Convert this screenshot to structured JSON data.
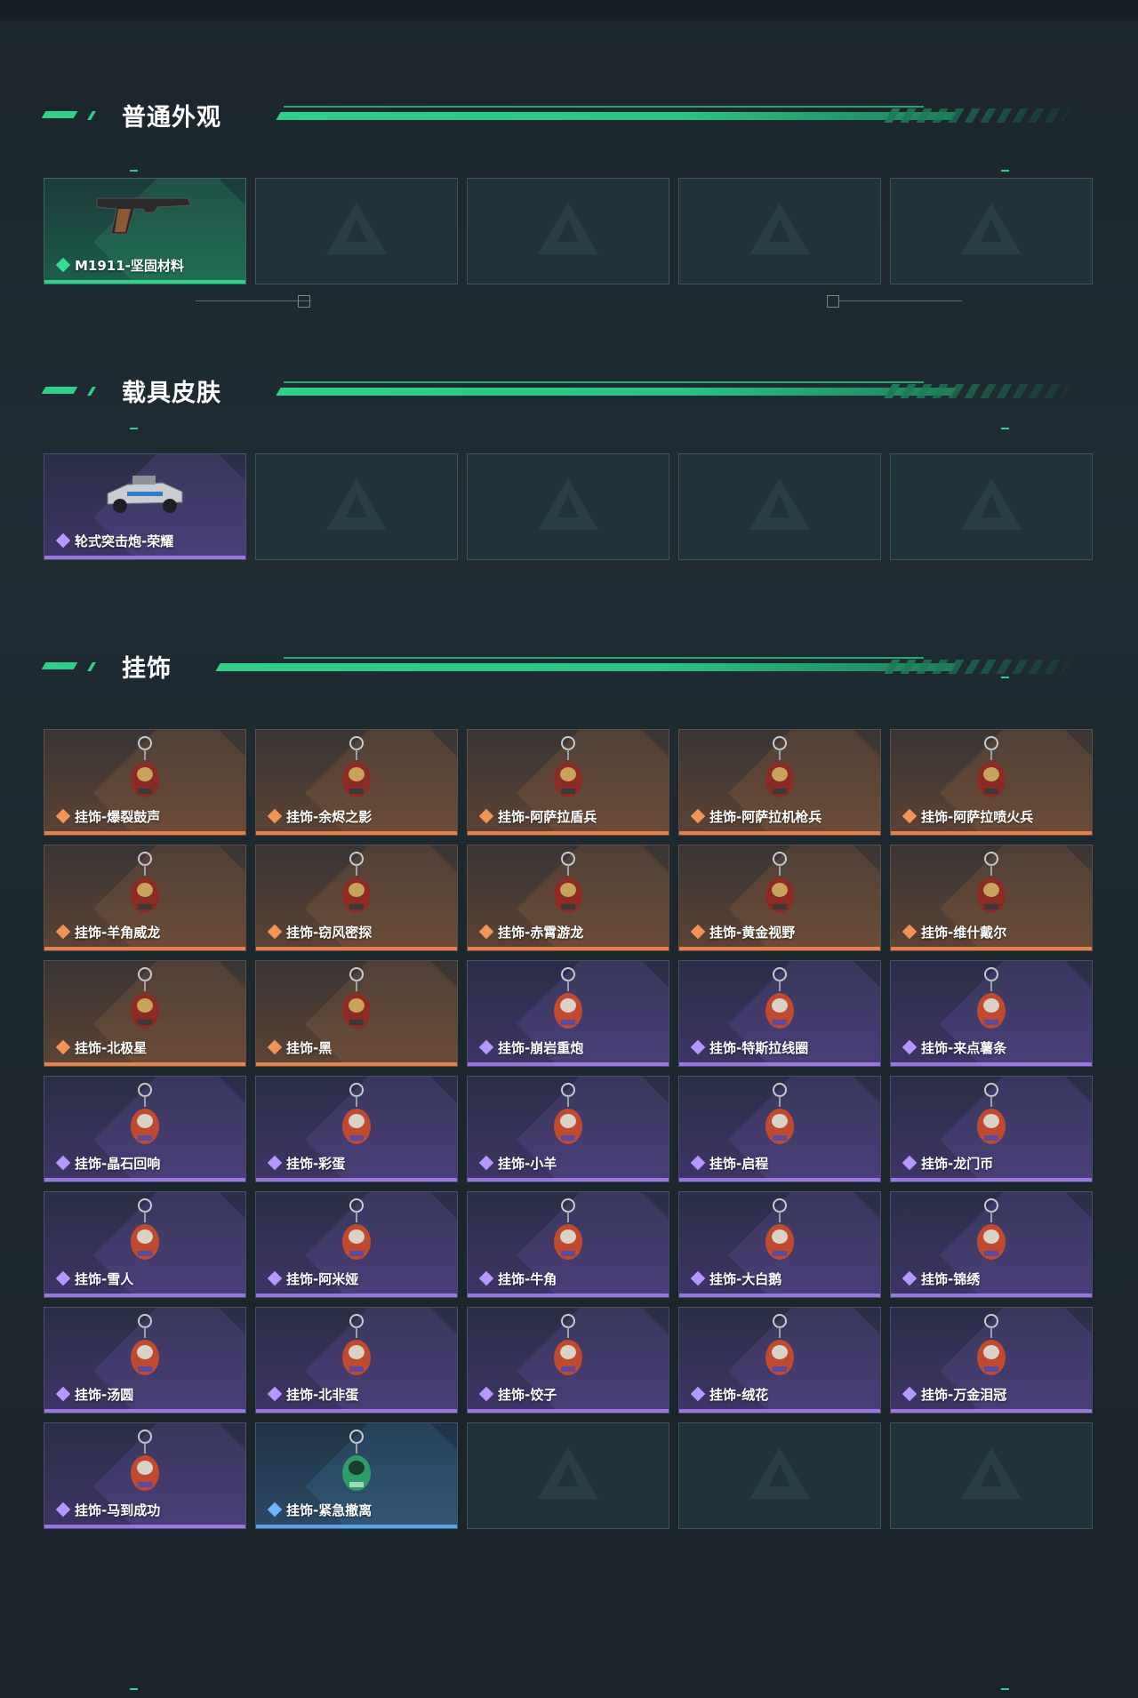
{
  "sections": {
    "appearance": {
      "title": "普通外观",
      "items": [
        {
          "label": "M1911-坚固材料",
          "rarity": "green"
        },
        {
          "label": "",
          "rarity": "empty"
        },
        {
          "label": "",
          "rarity": "empty"
        },
        {
          "label": "",
          "rarity": "empty"
        },
        {
          "label": "",
          "rarity": "empty"
        }
      ]
    },
    "vehicle": {
      "title": "载具皮肤",
      "items": [
        {
          "label": "轮式突击炮-荣耀",
          "rarity": "purple"
        },
        {
          "label": "",
          "rarity": "empty"
        },
        {
          "label": "",
          "rarity": "empty"
        },
        {
          "label": "",
          "rarity": "empty"
        },
        {
          "label": "",
          "rarity": "empty"
        }
      ]
    },
    "charms": {
      "title": "挂饰",
      "items": [
        {
          "label": "挂饰-爆裂鼓声",
          "rarity": "orange"
        },
        {
          "label": "挂饰-余烬之影",
          "rarity": "orange"
        },
        {
          "label": "挂饰-阿萨拉盾兵",
          "rarity": "orange"
        },
        {
          "label": "挂饰-阿萨拉机枪兵",
          "rarity": "orange"
        },
        {
          "label": "挂饰-阿萨拉喷火兵",
          "rarity": "orange"
        },
        {
          "label": "挂饰-羊角威龙",
          "rarity": "orange"
        },
        {
          "label": "挂饰-窃风密探",
          "rarity": "orange"
        },
        {
          "label": "挂饰-赤霄游龙",
          "rarity": "orange"
        },
        {
          "label": "挂饰-黄金视野",
          "rarity": "orange"
        },
        {
          "label": "挂饰-维什戴尔",
          "rarity": "orange"
        },
        {
          "label": "挂饰-北极星",
          "rarity": "orange"
        },
        {
          "label": "挂饰-黑",
          "rarity": "orange"
        },
        {
          "label": "挂饰-崩岩重炮",
          "rarity": "purple"
        },
        {
          "label": "挂饰-特斯拉线圈",
          "rarity": "purple"
        },
        {
          "label": "挂饰-来点薯条",
          "rarity": "purple"
        },
        {
          "label": "挂饰-晶石回响",
          "rarity": "purple"
        },
        {
          "label": "挂饰-彩蛋",
          "rarity": "purple"
        },
        {
          "label": "挂饰-小羊",
          "rarity": "purple"
        },
        {
          "label": "挂饰-启程",
          "rarity": "purple"
        },
        {
          "label": "挂饰-龙门币",
          "rarity": "purple"
        },
        {
          "label": "挂饰-雪人",
          "rarity": "purple"
        },
        {
          "label": "挂饰-阿米娅",
          "rarity": "purple"
        },
        {
          "label": "挂饰-牛角",
          "rarity": "purple"
        },
        {
          "label": "挂饰-大白鹅",
          "rarity": "purple"
        },
        {
          "label": "挂饰-锦绣",
          "rarity": "purple"
        },
        {
          "label": "挂饰-汤圆",
          "rarity": "purple"
        },
        {
          "label": "挂饰-北非蛋",
          "rarity": "purple"
        },
        {
          "label": "挂饰-饺子",
          "rarity": "purple"
        },
        {
          "label": "挂饰-绒花",
          "rarity": "purple"
        },
        {
          "label": "挂饰-万金泪冠",
          "rarity": "purple"
        },
        {
          "label": "挂饰-马到成功",
          "rarity": "purple"
        },
        {
          "label": "挂饰-紧急撤离",
          "rarity": "blue"
        },
        {
          "label": "",
          "rarity": "empty"
        },
        {
          "label": "",
          "rarity": "empty"
        },
        {
          "label": "",
          "rarity": "empty"
        }
      ]
    }
  },
  "colors": {
    "accent": "#2fd08a",
    "purple": "#9a77e0",
    "orange": "#e6814a",
    "blue": "#59a3e6"
  }
}
